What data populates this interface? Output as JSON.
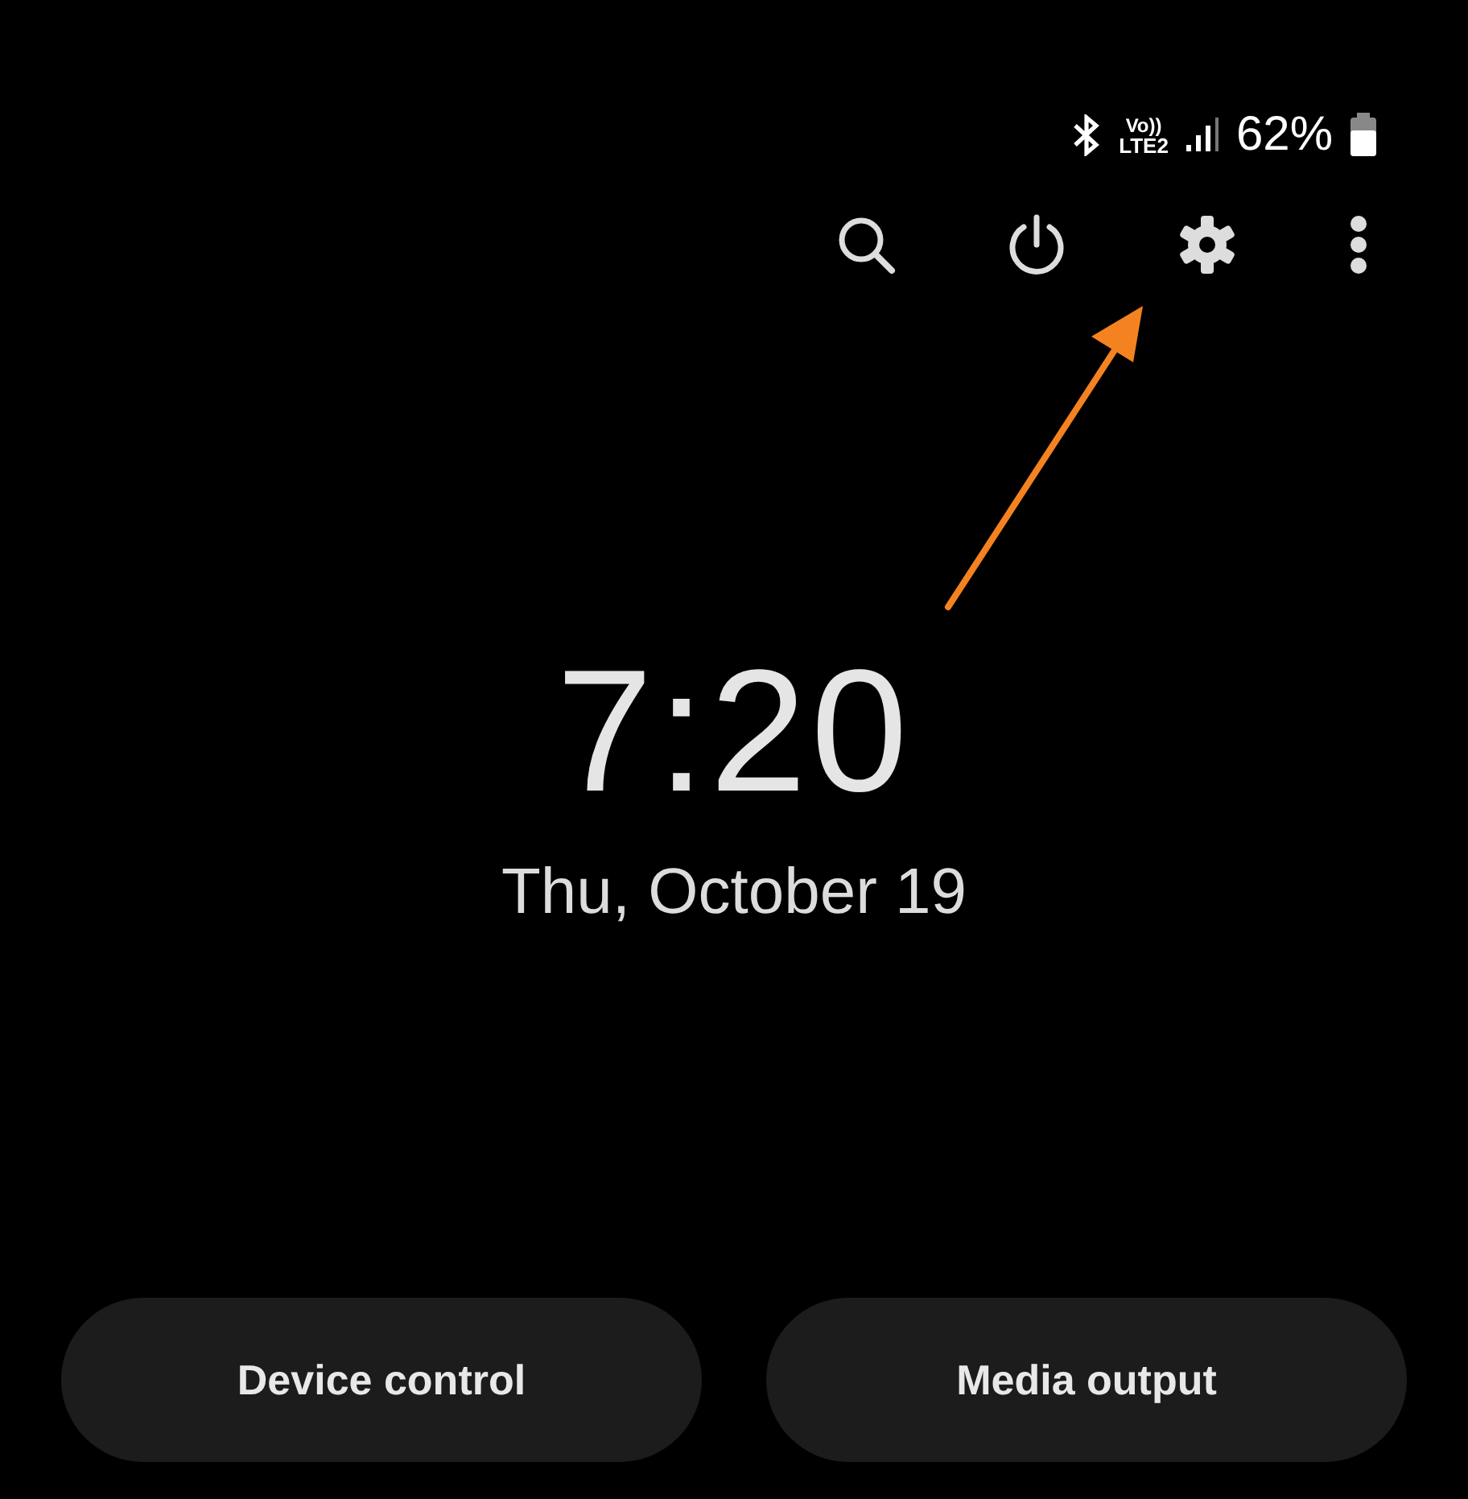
{
  "status_bar": {
    "volte": "Vo))",
    "network": "LTE2",
    "battery": "62%"
  },
  "clock": {
    "time": "7:20",
    "date": "Thu, October 19"
  },
  "buttons": [
    {
      "label": "Device control"
    },
    {
      "label": "Media output"
    }
  ]
}
